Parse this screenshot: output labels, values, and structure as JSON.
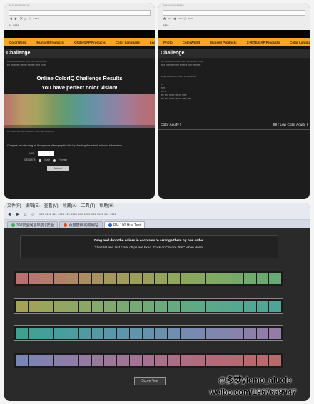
{
  "left_panel": {
    "nav": [
      "ColorWorld",
      "Munsell Products",
      "X-Rite/GAP Products",
      "Color Language",
      "Learn",
      "Register"
    ],
    "section_title": "Challenge",
    "results_title": "Online ColorIQ Challenge Results",
    "perfect_text": "You have perfect color vision!",
    "bottom_text": "Compare results using an Anonymous demographic data by checking the submit relevant information",
    "age_label": "AGE:",
    "gender_label": "GENDER:",
    "gender_options": [
      "Male",
      "Female"
    ],
    "submit_label": "Submit"
  },
  "right_panel": {
    "nav": [
      "Photo",
      "ColorWorld",
      "Munsell Products",
      "X-RITE/GAP Products",
      "Color Language",
      "Learn",
      "Register"
    ],
    "section_title": "Challenge",
    "bottom_left": "Color Acuity )",
    "bottom_right": "99 ( Low Color Acuity )"
  },
  "browser": {
    "menu": [
      "文件(F)",
      "编辑(E)",
      "查看(V)",
      "收藏(A)",
      "工具(T)",
      "帮助(H)"
    ],
    "toolbar": [
      "新建",
      "打开",
      "新标签",
      "前进",
      "后退"
    ],
    "tabs": [
      {
        "label": "360安全网址导航 | 安全",
        "color": "#3bb34a",
        "active": false
      },
      {
        "label": "百度搜索 购物网站",
        "color": "#e64a19",
        "active": false
      },
      {
        "label": "RM 100 Hue Test",
        "color": "#2a65d0",
        "active": true
      }
    ]
  },
  "game": {
    "instruction_1": "Drag and drop the colors in each row to arrange them by hue order.",
    "instruction_2": "The first and last color chips are fixed. Click on \"Score Test\" when done.",
    "score_button": "Score Test",
    "rows": [
      [
        "#b8716d",
        "#b67772",
        "#b47d6b",
        "#b18267",
        "#ae8765",
        "#ab8c63",
        "#a89161",
        "#a5965f",
        "#a29b5e",
        "#9e9e5c",
        "#9aa05c",
        "#95a35d",
        "#90a55e",
        "#8ba75f",
        "#86a862",
        "#80a964",
        "#7ba967",
        "#75a96a",
        "#70aa6d",
        "#6ba970",
        "#66a974"
      ],
      [
        "#a3a256",
        "#9ea25a",
        "#99a45d",
        "#94a561",
        "#8fa664",
        "#8aa768",
        "#85a86b",
        "#80a96f",
        "#7ba972",
        "#76a975",
        "#71a979",
        "#6ca97c",
        "#67a980",
        "#62a983",
        "#5ea987",
        "#5aa98a",
        "#57a88d",
        "#54a791",
        "#52a694",
        "#50a597",
        "#4fa49a"
      ],
      [
        "#3fa090",
        "#42a095",
        "#459f99",
        "#489e9d",
        "#4c9da0",
        "#509ba3",
        "#549aa6",
        "#5898a8",
        "#5d96aa",
        "#6294ac",
        "#6692ad",
        "#6b90ae",
        "#708eaf",
        "#758baf",
        "#7a89af",
        "#7f87ae",
        "#8385ad",
        "#8882ac",
        "#8c80aa",
        "#917ea8",
        "#957ca6"
      ],
      [
        "#7a85b3",
        "#7f83b0",
        "#8481ad",
        "#897fa9",
        "#8e7da6",
        "#937ba2",
        "#97799e",
        "#9b779a",
        "#9f7596",
        "#a37392",
        "#a6718e",
        "#a9708a",
        "#ac6e86",
        "#ae6d82",
        "#b06c7e",
        "#b26b7a",
        "#b46b77",
        "#b56a73",
        "#b66a70",
        "#b7696d",
        "#b8696a"
      ]
    ]
  },
  "watermark": {
    "line1": "@多梦yiemo_aluoie",
    "line2": "weibo.com/1967639947"
  }
}
